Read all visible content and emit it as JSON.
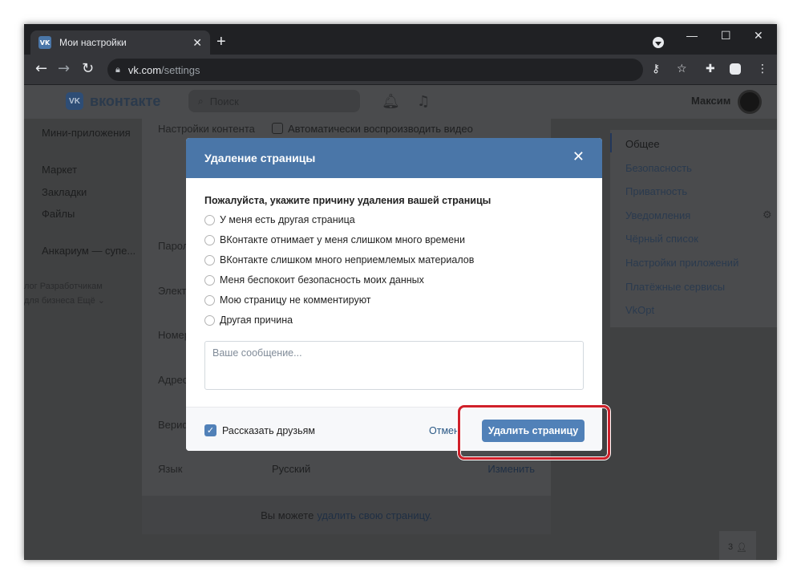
{
  "browser": {
    "tab_title": "Мои настройки",
    "tab_favicon": "VK",
    "url_host": "vk.com",
    "url_path": "/settings",
    "icons": [
      "back-icon",
      "forward-icon",
      "reload-icon",
      "lock-icon",
      "key-icon",
      "star-icon",
      "extensions-icon",
      "profile-icon",
      "menu-icon"
    ]
  },
  "vk_header": {
    "logo_text": "вконтакте",
    "logo_mark": "VK",
    "search_placeholder": "Поиск",
    "user_name": "Максим"
  },
  "left_nav": {
    "items": [
      "Мини-приложения",
      "Маркет",
      "Закладки",
      "Файлы",
      "Анкариум — супе..."
    ],
    "footer_row1": "лог   Разработчикам",
    "footer_row2": "для бизнеса   Ещё ⌄"
  },
  "settings_content": {
    "content_label": "Настройки контента",
    "autoplay_label": "Автоматически воспроизводить видео",
    "rows": [
      "Парол",
      "Электр",
      "Номер",
      "Адрес",
      "Вериф"
    ],
    "language_label": "Язык",
    "language_value": "Русский",
    "language_action": "Изменить",
    "footer_text": "Вы можете",
    "footer_link": "удалить свою страницу."
  },
  "right_menu": {
    "items": [
      "Общее",
      "Безопасность",
      "Приватность",
      "Уведомления",
      "Чёрный список",
      "Настройки приложений",
      "Платёжные сервисы",
      "VkOpt"
    ]
  },
  "online_counter": "3",
  "modal": {
    "title": "Удаление страницы",
    "question": "Пожалуйста, укажите причину удаления вашей страницы",
    "reasons": [
      "У меня есть другая страница",
      "ВКонтакте отнимает у меня слишком много времени",
      "ВКонтакте слишком много неприемлемых материалов",
      "Меня беспокоит безопасность моих данных",
      "Мою страницу не комментируют",
      "Другая причина"
    ],
    "message_placeholder": "Ваше сообщение...",
    "share_label": "Рассказать друзьям",
    "share_checked": true,
    "cancel_label": "Отмена",
    "delete_label": "Удалить страницу"
  },
  "colors": {
    "accent": "#4a76a8",
    "button": "#5181b8",
    "highlight": "#d0202a"
  }
}
